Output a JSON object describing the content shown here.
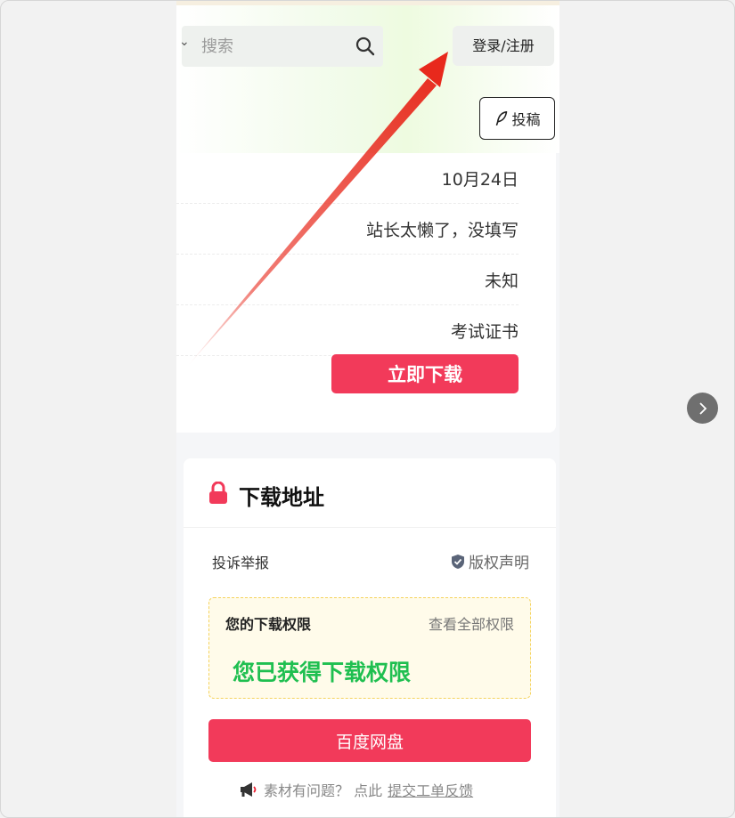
{
  "header": {
    "search_placeholder": "搜索",
    "login_label": "登录/注册",
    "post_label": "投稿"
  },
  "info": {
    "rows": [
      "10月24日",
      "站长太懒了，没填写",
      "未知",
      "考试证书"
    ],
    "download_now": "立即下载"
  },
  "download": {
    "title": "下载地址",
    "report": "投诉举报",
    "copyright": "版权声明",
    "permission_label": "您的下载权限",
    "permission_all": "查看全部权限",
    "permission_granted": "您已获得下载权限",
    "baidu_button": "百度网盘",
    "feedback_text": "素材有问题？ 点此",
    "feedback_link": "提交工单反馈"
  },
  "colors": {
    "accent_red": "#f23a5a",
    "success_green": "#1fbf50",
    "annotation_arrow": "#e8291c"
  }
}
